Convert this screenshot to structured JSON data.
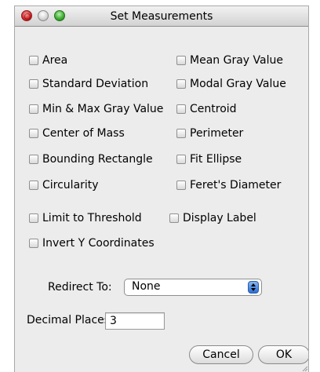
{
  "window": {
    "title": "Set Measurements"
  },
  "checkboxes": [
    {
      "label": "Area",
      "checked": false
    },
    {
      "label": "Mean Gray Value",
      "checked": false
    },
    {
      "label": "Standard Deviation",
      "checked": false
    },
    {
      "label": "Modal Gray Value",
      "checked": false
    },
    {
      "label": "Min & Max Gray Value",
      "checked": false
    },
    {
      "label": "Centroid",
      "checked": false
    },
    {
      "label": "Center of Mass",
      "checked": false
    },
    {
      "label": "Perimeter",
      "checked": false
    },
    {
      "label": "Bounding Rectangle",
      "checked": false
    },
    {
      "label": "Fit Ellipse",
      "checked": false
    },
    {
      "label": "Circularity",
      "checked": false
    },
    {
      "label": "Feret's Diameter",
      "checked": false
    },
    {
      "label": "Limit to Threshold",
      "checked": false
    },
    {
      "label": "Display Label",
      "checked": false
    },
    {
      "label": "Invert Y Coordinates",
      "checked": false
    }
  ],
  "redirect": {
    "label": "Redirect To:",
    "value": "None"
  },
  "decimal": {
    "label": "Decimal Places:",
    "value": "3"
  },
  "buttons": {
    "cancel": "Cancel",
    "ok": "OK"
  }
}
